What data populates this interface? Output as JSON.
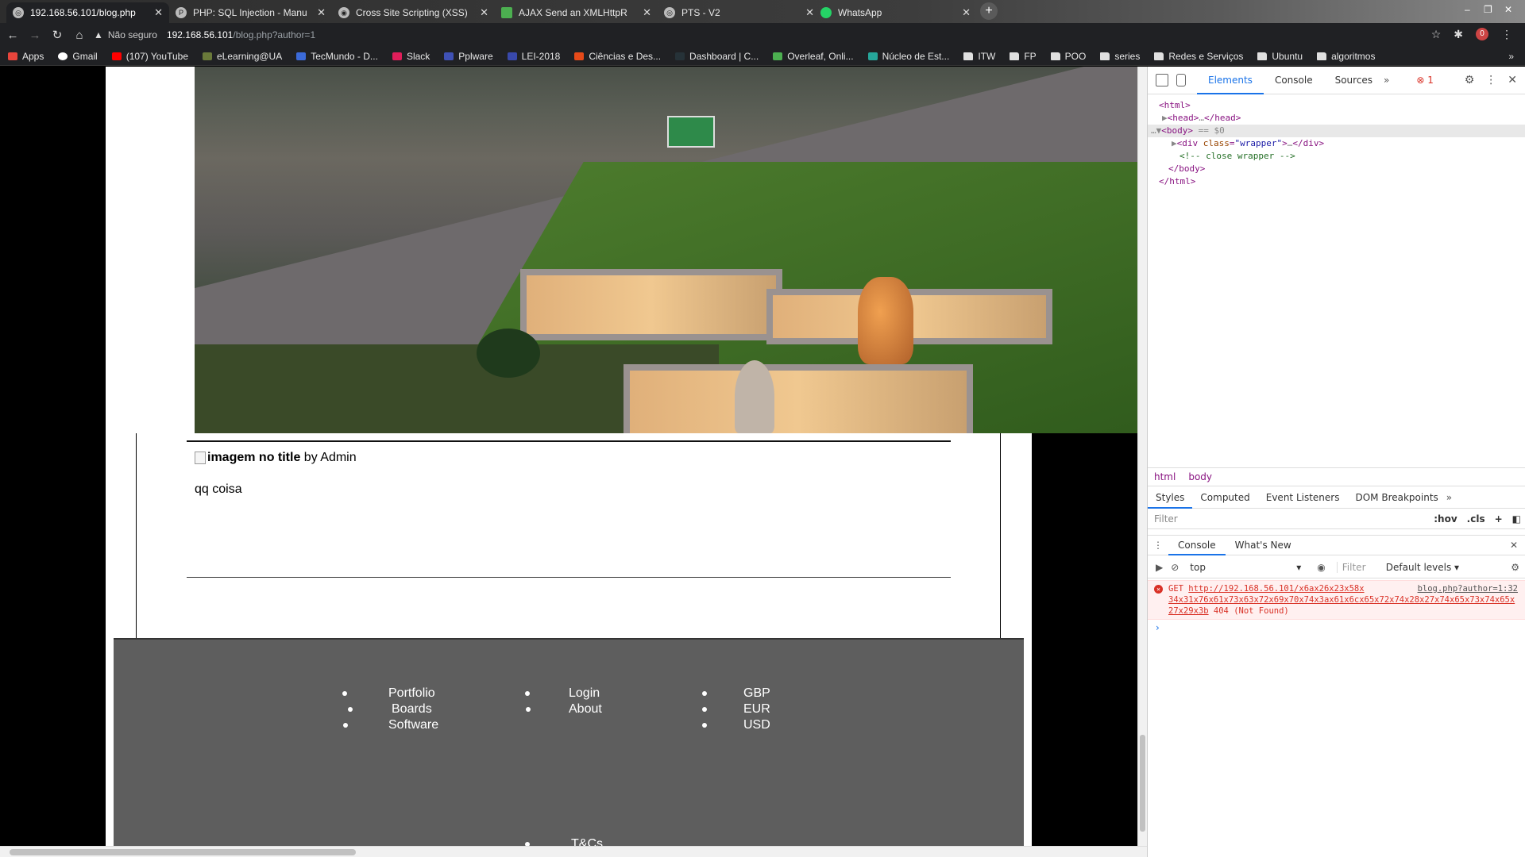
{
  "tabs": [
    {
      "title": "192.168.56.101/blog.php",
      "active": true
    },
    {
      "title": "PHP: SQL Injection - Manu",
      "active": false
    },
    {
      "title": "Cross Site Scripting (XSS)",
      "active": false
    },
    {
      "title": "AJAX Send an XMLHttpR",
      "active": false
    },
    {
      "title": "PTS - V2",
      "active": false
    },
    {
      "title": "WhatsApp",
      "active": false
    }
  ],
  "address": {
    "security_label": "Não seguro",
    "host": "192.168.56.101",
    "path": "/blog.php?author=1"
  },
  "extensions_badge": "0",
  "bookmarks": [
    "Apps",
    "Gmail",
    "(107) YouTube",
    "eLearning@UA",
    "TecMundo - D...",
    "Slack",
    "Pplware",
    "LEI-2018",
    "Ciências e Des...",
    "Dashboard | C...",
    "Overleaf, Onli...",
    "Núcleo de Est...",
    "ITW",
    "FP",
    "POO",
    "series",
    "Redes e Serviços",
    "Ubuntu",
    "algoritmos"
  ],
  "post": {
    "title": "imagem no title",
    "byline": " by Admin",
    "body": "qq coisa"
  },
  "footer": {
    "col1": [
      "Portfolio",
      "Boards",
      "Software"
    ],
    "col2": [
      "Login",
      "About"
    ],
    "col3": [
      "GBP",
      "EUR",
      "USD"
    ],
    "col4": [
      "T&Cs"
    ]
  },
  "devtools": {
    "tabs": [
      "Elements",
      "Console",
      "Sources"
    ],
    "error_count": "1",
    "breadcrumbs": [
      "html",
      "body"
    ],
    "style_tabs": [
      "Styles",
      "Computed",
      "Event Listeners",
      "DOM Breakpoints"
    ],
    "filter_placeholder": "Filter",
    "hov": ":hov",
    "cls": ".cls",
    "drawer_tabs": [
      "Console",
      "What's New"
    ],
    "context": "top",
    "console_filter": "Filter",
    "levels": "Default levels",
    "error": {
      "method": "GET ",
      "url": "http://192.168.56.101/x6ax26x23x58x",
      "source": "blog.php?author=1:32",
      "tail": "34x31x76x61x73x63x72x69x70x74x3ax61x6cx65x72x74x28x27x74x65x73x74x65x27x29x3b",
      "status": "404 (Not Found)"
    }
  }
}
